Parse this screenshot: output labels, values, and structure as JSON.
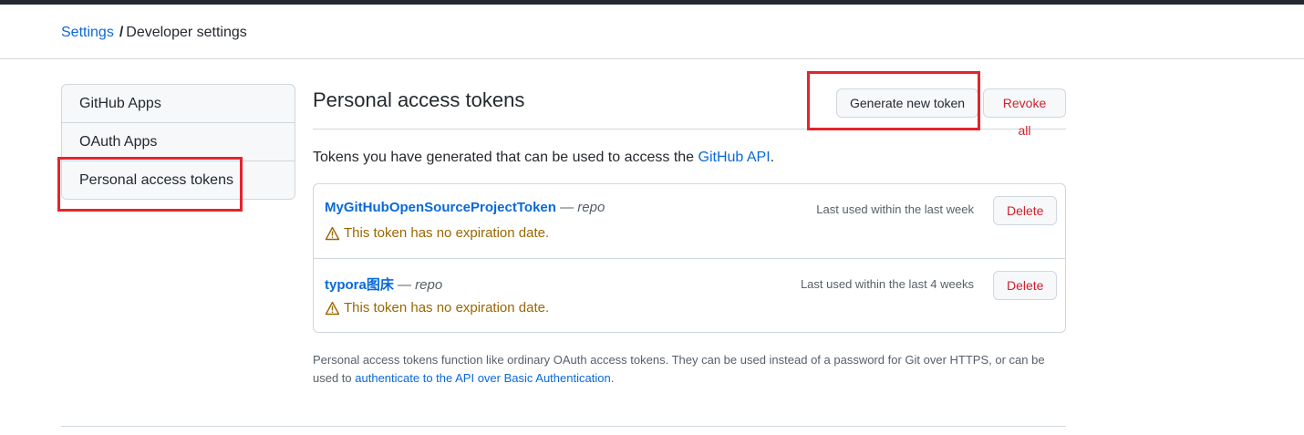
{
  "breadcrumb": {
    "parent": "Settings",
    "separator": "/",
    "current": "Developer settings"
  },
  "sidebar": {
    "items": [
      {
        "label": "GitHub Apps"
      },
      {
        "label": "OAuth Apps"
      },
      {
        "label": "Personal access tokens"
      }
    ]
  },
  "main": {
    "title": "Personal access tokens",
    "generate_label": "Generate new token",
    "revoke_label": "Revoke all",
    "description_before": "Tokens you have generated that can be used to access the ",
    "description_link": "GitHub API",
    "description_after": "."
  },
  "tokens": [
    {
      "name": "MyGitHubOpenSourceProjectToken",
      "scope": " — repo",
      "warning": "This token has no expiration date.",
      "last_used": "Last used within the last week",
      "delete_label": "Delete"
    },
    {
      "name": "typora图床",
      "scope": " — repo",
      "warning": "This token has no expiration date.",
      "last_used": "Last used within the last 4 weeks",
      "delete_label": "Delete"
    }
  ],
  "footer": {
    "text_before": "Personal access tokens function like ordinary OAuth access tokens. They can be used instead of a password for Git over HTTPS, or can be used to ",
    "link": "authenticate to the API over Basic Authentication",
    "text_after": "."
  },
  "colors": {
    "link": "#0969da",
    "danger": "#cf222e",
    "warning": "#9a6700",
    "highlight": "#e5242b"
  },
  "icons": {
    "warning": "alert-icon"
  }
}
